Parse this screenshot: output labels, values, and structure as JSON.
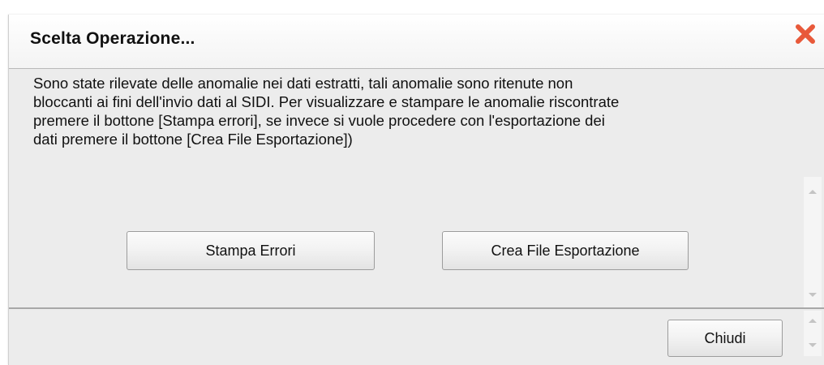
{
  "dialog": {
    "title": "Scelta Operazione...",
    "close_icon": "close-icon",
    "close_color": "#e8593a",
    "message": "Sono state rilevate delle anomalie nei dati estratti, tali anomalie sono ritenute non\nbloccanti ai fini dell'invio dati al SIDI. Per visualizzare e stampare le anomalie riscontrate\npremere il bottone [Stampa errori], se invece si vuole procedere con l'esportazione dei\ndati premere il bottone [Crea File Esportazione])",
    "buttons": {
      "stampa_errori": "Stampa Errori",
      "crea_file": "Crea File Esportazione"
    },
    "footer": {
      "chiudi": "Chiudi"
    }
  }
}
